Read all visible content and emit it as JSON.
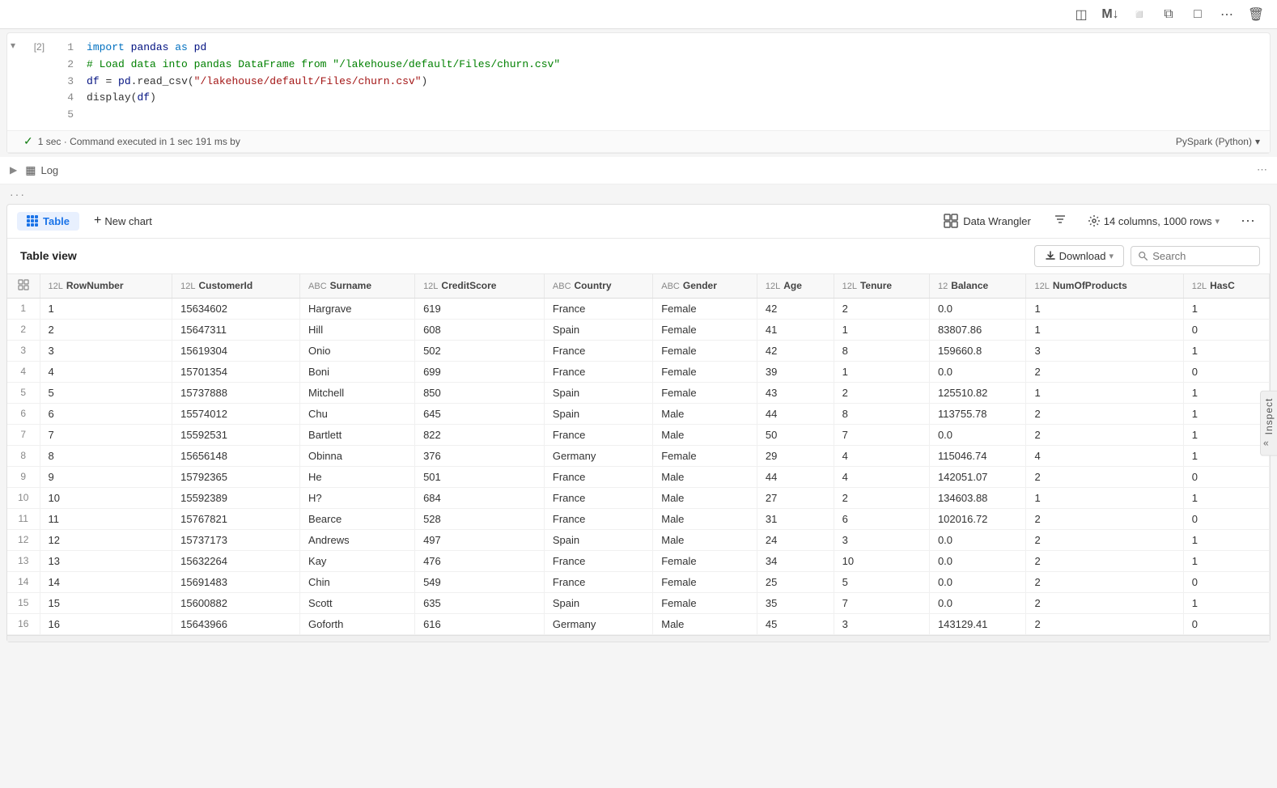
{
  "topbar": {
    "icons": [
      "layout-icon",
      "markdown-icon",
      "display-icon",
      "copy-icon",
      "chat-icon",
      "more-icon",
      "delete-icon"
    ]
  },
  "cell": {
    "number": "[2]",
    "lines": [
      {
        "num": "1",
        "tokens": [
          {
            "text": "import ",
            "cls": "kw"
          },
          {
            "text": "pandas",
            "cls": "var"
          },
          {
            "text": " as ",
            "cls": "kw"
          },
          {
            "text": "pd",
            "cls": "var"
          }
        ]
      },
      {
        "num": "2",
        "tokens": [
          {
            "text": "# Load data into pandas DataFrame from \"/lakehouse/default/Files/churn.csv\"",
            "cls": "comment"
          }
        ]
      },
      {
        "num": "3",
        "tokens": [
          {
            "text": "df",
            "cls": "var"
          },
          {
            "text": " = ",
            "cls": ""
          },
          {
            "text": "pd",
            "cls": "var"
          },
          {
            "text": ".read_csv(",
            "cls": ""
          },
          {
            "text": "\"/lakehouse/default/Files/churn.csv\"",
            "cls": "str"
          },
          {
            "text": ")",
            "cls": ""
          }
        ]
      },
      {
        "num": "4",
        "tokens": [
          {
            "text": "display(",
            "cls": ""
          },
          {
            "text": "df",
            "cls": "var"
          },
          {
            "text": ")",
            "cls": ""
          }
        ]
      },
      {
        "num": "5",
        "tokens": []
      }
    ],
    "exec_status": "1 sec · Command executed in 1 sec 191 ms by",
    "runtime": "PySpark (Python)"
  },
  "log": {
    "label": "Log"
  },
  "output": {
    "table_tab": "Table",
    "new_chart": "New chart",
    "data_wrangler": "Data Wrangler",
    "col_info": "14 columns, 1000 rows",
    "table_view_title": "Table view",
    "download_label": "Download",
    "search_placeholder": "Search",
    "columns": [
      {
        "type": "12L",
        "name": "RowNumber"
      },
      {
        "type": "12L",
        "name": "CustomerId"
      },
      {
        "type": "ABC",
        "name": "Surname"
      },
      {
        "type": "12L",
        "name": "CreditScore"
      },
      {
        "type": "ABC",
        "name": "Country"
      },
      {
        "type": "ABC",
        "name": "Gender"
      },
      {
        "type": "12L",
        "name": "Age"
      },
      {
        "type": "12L",
        "name": "Tenure"
      },
      {
        "type": "12",
        "name": "Balance"
      },
      {
        "type": "12L",
        "name": "NumOfProducts"
      },
      {
        "type": "12L",
        "name": "HasC"
      }
    ],
    "rows": [
      [
        1,
        1,
        15634602,
        "Hargrave",
        619,
        "France",
        "Female",
        42,
        2,
        "0.0",
        1,
        1
      ],
      [
        2,
        2,
        15647311,
        "Hill",
        608,
        "Spain",
        "Female",
        41,
        1,
        "83807.86",
        1,
        0
      ],
      [
        3,
        3,
        15619304,
        "Onio",
        502,
        "France",
        "Female",
        42,
        8,
        "159660.8",
        3,
        1
      ],
      [
        4,
        4,
        15701354,
        "Boni",
        699,
        "France",
        "Female",
        39,
        1,
        "0.0",
        2,
        0
      ],
      [
        5,
        5,
        15737888,
        "Mitchell",
        850,
        "Spain",
        "Female",
        43,
        2,
        "125510.82",
        1,
        1
      ],
      [
        6,
        6,
        15574012,
        "Chu",
        645,
        "Spain",
        "Male",
        44,
        8,
        "113755.78",
        2,
        1
      ],
      [
        7,
        7,
        15592531,
        "Bartlett",
        822,
        "France",
        "Male",
        50,
        7,
        "0.0",
        2,
        1
      ],
      [
        8,
        8,
        15656148,
        "Obinna",
        376,
        "Germany",
        "Female",
        29,
        4,
        "115046.74",
        4,
        1
      ],
      [
        9,
        9,
        15792365,
        "He",
        501,
        "France",
        "Male",
        44,
        4,
        "142051.07",
        2,
        0
      ],
      [
        10,
        10,
        15592389,
        "H?",
        684,
        "France",
        "Male",
        27,
        2,
        "134603.88",
        1,
        1
      ],
      [
        11,
        11,
        15767821,
        "Bearce",
        528,
        "France",
        "Male",
        31,
        6,
        "102016.72",
        2,
        0
      ],
      [
        12,
        12,
        15737173,
        "Andrews",
        497,
        "Spain",
        "Male",
        24,
        3,
        "0.0",
        2,
        1
      ],
      [
        13,
        13,
        15632264,
        "Kay",
        476,
        "France",
        "Female",
        34,
        10,
        "0.0",
        2,
        1
      ],
      [
        14,
        14,
        15691483,
        "Chin",
        549,
        "France",
        "Female",
        25,
        5,
        "0.0",
        2,
        0
      ],
      [
        15,
        15,
        15600882,
        "Scott",
        635,
        "Spain",
        "Female",
        35,
        7,
        "0.0",
        2,
        1
      ],
      [
        16,
        16,
        15643966,
        "Goforth",
        616,
        "Germany",
        "Male",
        45,
        3,
        "143129.41",
        2,
        0
      ]
    ]
  }
}
